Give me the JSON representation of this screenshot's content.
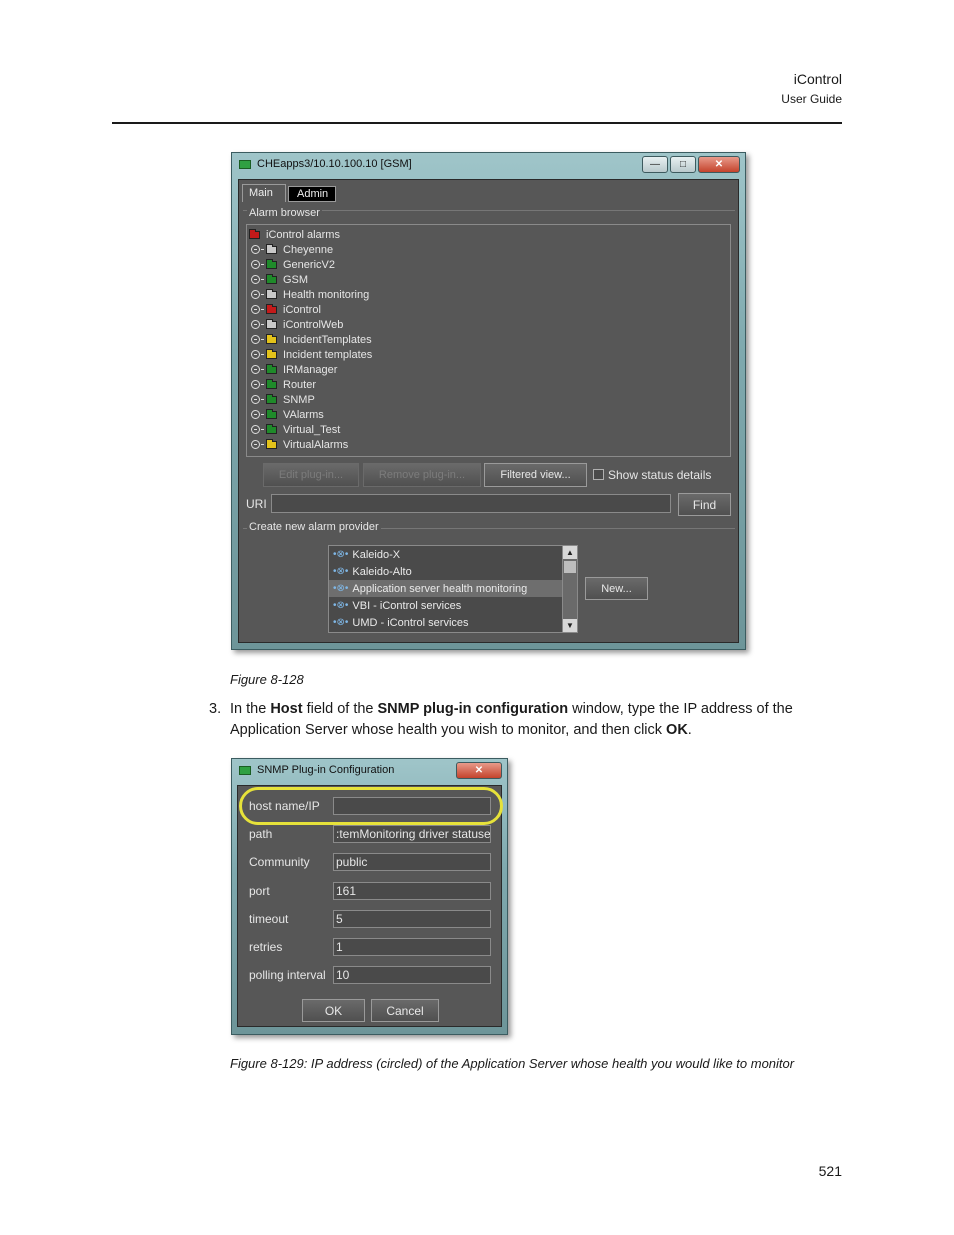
{
  "header": {
    "product": "iControl",
    "doc": "User Guide"
  },
  "window1": {
    "title": "CHEapps3/10.10.100.10 [GSM]",
    "tabs": [
      {
        "label": "Main"
      },
      {
        "label": "Admin"
      }
    ],
    "alarm_browser": {
      "label": "Alarm browser",
      "root": "iControl alarms",
      "items": [
        {
          "label": "Cheyenne",
          "folder": "grey"
        },
        {
          "label": "GenericV2",
          "folder": "green"
        },
        {
          "label": "GSM",
          "folder": "green"
        },
        {
          "label": "Health monitoring",
          "folder": "grey"
        },
        {
          "label": "iControl",
          "folder": "red"
        },
        {
          "label": "iControlWeb",
          "folder": "grey"
        },
        {
          "label": "IncidentTemplates",
          "folder": "yellow"
        },
        {
          "label": "Incident templates",
          "folder": "yellow"
        },
        {
          "label": "IRManager",
          "folder": "green"
        },
        {
          "label": "Router",
          "folder": "green"
        },
        {
          "label": "SNMP",
          "folder": "green"
        },
        {
          "label": "VAlarms",
          "folder": "green"
        },
        {
          "label": "Virtual_Test",
          "folder": "green"
        },
        {
          "label": "VirtualAlarms",
          "folder": "yellow"
        }
      ],
      "edit_plugin": "Edit plug-in...",
      "remove_plugin": "Remove plug-in...",
      "filtered_view": "Filtered view...",
      "show_status": "Show status details",
      "uri_label": "URI",
      "uri_value": "",
      "find": "Find"
    },
    "create_provider": {
      "label": "Create new alarm provider",
      "items": [
        {
          "label": "Kaleido-X",
          "selected": false
        },
        {
          "label": "Kaleido-Alto",
          "selected": false
        },
        {
          "label": "Application server health monitoring",
          "selected": true
        },
        {
          "label": "VBI - iControl services",
          "selected": false
        },
        {
          "label": "UMD - iControl services",
          "selected": false
        }
      ],
      "new_button": "New..."
    }
  },
  "figure1_caption": "Figure 8-128",
  "instruction": {
    "number": "3.",
    "parts": [
      "In the ",
      "Host",
      " field of the ",
      "SNMP plug-in configuration",
      " window, type the IP address of the Application Server whose health you wish to monitor, and then click ",
      "OK",
      "."
    ]
  },
  "window2": {
    "title": "SNMP Plug-in Configuration",
    "fields": [
      {
        "label": "host name/IP",
        "value": ""
      },
      {
        "label": "path",
        "value": ":temMonitoring driver statuses"
      },
      {
        "label": "Community",
        "value": "public"
      },
      {
        "label": "port",
        "value": "161"
      },
      {
        "label": "timeout",
        "value": "5"
      },
      {
        "label": "retries",
        "value": "1"
      },
      {
        "label": "polling interval",
        "value": "10"
      }
    ],
    "ok": "OK",
    "cancel": "Cancel"
  },
  "figure2_caption": "Figure 8-129:  IP address (circled) of the Application Server whose health you would like to monitor",
  "page_number": "521",
  "colors": {
    "folder_grey": "#c8c8c8",
    "folder_green": "#1f8a2a",
    "folder_red": "#c41a1a",
    "folder_yellow": "#e3c21a",
    "highlight_circle": "#e6e23a"
  }
}
